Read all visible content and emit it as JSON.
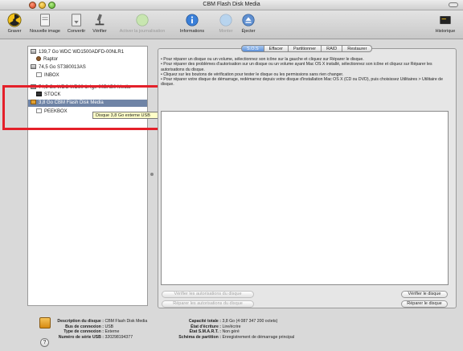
{
  "window": {
    "title": "CBM Flash Disk Media"
  },
  "toolbar": {
    "items": [
      {
        "label": "Graver",
        "enabled": true
      },
      {
        "label": "Nouvelle image",
        "enabled": true
      },
      {
        "label": "Convertir",
        "enabled": true
      },
      {
        "label": "Vérifier",
        "enabled": true
      },
      {
        "label": "Activer la journalisation",
        "enabled": false
      },
      {
        "label": "Informations",
        "enabled": true
      },
      {
        "label": "Monter",
        "enabled": false
      },
      {
        "label": "Éjecter",
        "enabled": true
      },
      {
        "label": "Historique",
        "enabled": true
      }
    ]
  },
  "sidebar": {
    "items": [
      {
        "label": "139,7 Go WDC WD1500ADFD-00NLR1",
        "level": 0,
        "icon": "hard-disk-icon"
      },
      {
        "label": "Raptor",
        "level": 1,
        "icon": "volume-icon"
      },
      {
        "label": "74,5 Go ST380013AS",
        "level": 0,
        "icon": "hard-disk-icon"
      },
      {
        "label": "INBOX",
        "level": 1,
        "icon": "volume-icon"
      },
      {
        "label": "74,5 Go WDC WD80 1.4ge-00BAB0 Media",
        "level": 0,
        "icon": "hard-disk-icon"
      },
      {
        "label": "STOCK",
        "level": 1,
        "icon": "volume-icon"
      },
      {
        "label": "3,8 Go CBM Flash Disk Media",
        "level": 0,
        "icon": "usb-disk-icon",
        "selected": true
      },
      {
        "label": "PEEKBOX",
        "level": 1,
        "icon": "volume-icon"
      }
    ],
    "tooltip": "Disque 3,8 Go externe USB"
  },
  "tabs": [
    {
      "label": "S.O.S",
      "active": true
    },
    {
      "label": "Effacer",
      "active": false
    },
    {
      "label": "Partitionner",
      "active": false
    },
    {
      "label": "RAID",
      "active": false
    },
    {
      "label": "Restaurer",
      "active": false
    }
  ],
  "instructions": [
    "• Pour réparer un disque ou un volume, sélectionnez son icône sur la gauche et cliquez sur Réparer le disque.",
    "• Pour réparer des problèmes d'autorisation sur un disque ou un volume ayant Mac OS X installé, sélectionnez son icône et cliquez sur Réparer les autorisations du disque.",
    "• Cliquez sur les boutons de vérification pour tester le disque ou les permissions sans rien changer.",
    "• Pour réparer votre disque de démarrage, redémarrez depuis votre disque d'installation Mac OS X (CD ou DVD), puis choisissez Utilitaires > Utilitaire de disque."
  ],
  "buttons": {
    "verify_permissions": "Vérifier les autorisations du disque",
    "repair_permissions": "Réparer les autorisations du disque",
    "verify_disk": "Vérifier le disque",
    "repair_disk": "Réparer le disque"
  },
  "info": {
    "left": [
      {
        "key": "Description du disque :",
        "value": "CBM Flash Disk Media"
      },
      {
        "key": "Bus de connexion :",
        "value": "USB"
      },
      {
        "key": "Type de connexion :",
        "value": "Externe"
      },
      {
        "key": "Numéro de série USB :",
        "value": "320298194377"
      }
    ],
    "right": [
      {
        "key": "Capacité totale :",
        "value": "3,8 Go (4 087 347 200 octets)"
      },
      {
        "key": "État d'écriture :",
        "value": "Lire/écrire"
      },
      {
        "key": "État S.M.A.R.T. :",
        "value": "Non géré"
      },
      {
        "key": "Schéma de partition :",
        "value": "Enregistrement de démarrage principal"
      }
    ]
  },
  "colors": {
    "selection": "#6f84a6",
    "highlight_box": "#e4202a",
    "tab_active": "#5b8fd8",
    "tooltip": "#ffffc8"
  }
}
